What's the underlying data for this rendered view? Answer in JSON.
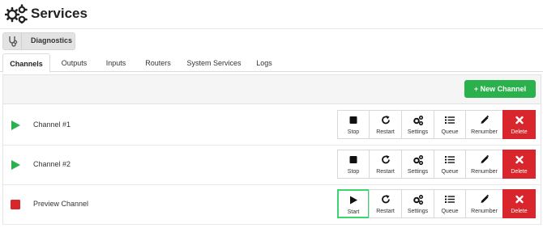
{
  "header": {
    "title": "Services",
    "icon": "gears-icon"
  },
  "diagnostics": {
    "label": "Diagnostics",
    "icon": "stethoscope-icon"
  },
  "tabs": [
    {
      "label": "Channels",
      "active": true
    },
    {
      "label": "Outputs"
    },
    {
      "label": "Inputs"
    },
    {
      "label": "Routers"
    },
    {
      "label": "System Services"
    },
    {
      "label": "Logs"
    }
  ],
  "toolbar": {
    "new_channel_label": "+ New Channel"
  },
  "colors": {
    "accent_green": "#2ab14b",
    "delete_red": "#d9262d",
    "focus_green": "#3bd46f"
  },
  "channels": [
    {
      "name": "Channel #1",
      "status": "running",
      "actions": [
        {
          "label": "Stop",
          "icon": "stop-icon"
        },
        {
          "label": "Restart",
          "icon": "restart-icon"
        },
        {
          "label": "Settings",
          "icon": "settings-icon"
        },
        {
          "label": "Queue",
          "icon": "queue-icon"
        },
        {
          "label": "Renumber",
          "icon": "pencil-icon"
        },
        {
          "label": "Delete",
          "icon": "close-icon"
        }
      ]
    },
    {
      "name": "Channel #2",
      "status": "running",
      "actions": [
        {
          "label": "Stop",
          "icon": "stop-icon"
        },
        {
          "label": "Restart",
          "icon": "restart-icon"
        },
        {
          "label": "Settings",
          "icon": "settings-icon"
        },
        {
          "label": "Queue",
          "icon": "queue-icon"
        },
        {
          "label": "Renumber",
          "icon": "pencil-icon"
        },
        {
          "label": "Delete",
          "icon": "close-icon"
        }
      ]
    },
    {
      "name": "Preview Channel",
      "status": "stopped",
      "actions": [
        {
          "label": "Start",
          "icon": "play-icon"
        },
        {
          "label": "Restart",
          "icon": "restart-icon"
        },
        {
          "label": "Settings",
          "icon": "settings-icon"
        },
        {
          "label": "Queue",
          "icon": "queue-icon"
        },
        {
          "label": "Renumber",
          "icon": "pencil-icon"
        },
        {
          "label": "Delete",
          "icon": "close-icon"
        }
      ]
    }
  ]
}
